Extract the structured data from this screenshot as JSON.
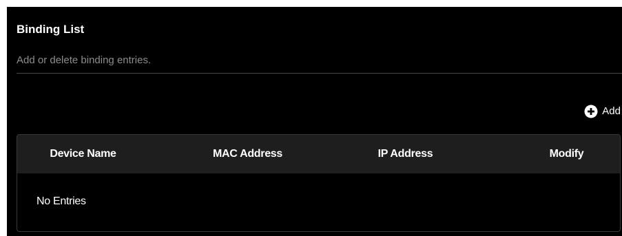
{
  "section": {
    "title": "Binding List",
    "description": "Add or delete binding entries."
  },
  "toolbar": {
    "add_label": "Add",
    "add_icon": "plus-circle-icon"
  },
  "table": {
    "columns": [
      "Device Name",
      "MAC Address",
      "IP Address",
      "Modify"
    ],
    "empty_text": "No Entries",
    "rows": []
  },
  "colors": {
    "background": "#000000",
    "header_background": "#1e1e1e",
    "text": "#ffffff",
    "muted_text": "#8c8c8c",
    "divider": "#4a4a4a"
  }
}
